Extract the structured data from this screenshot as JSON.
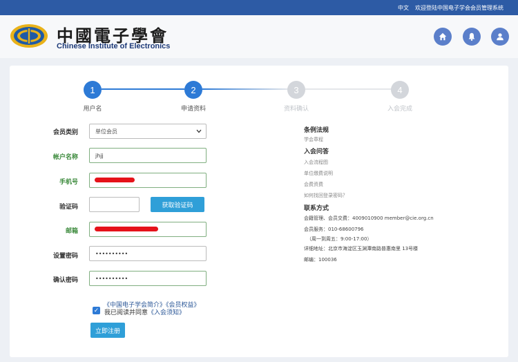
{
  "topbar": {
    "language": "中文",
    "welcome": "欢迎登陆中国电子学会会员管理系统"
  },
  "header": {
    "logo_cn": "中國電子學會",
    "logo_en": "Chinese Institute of Electronics"
  },
  "steps": [
    {
      "num": "1",
      "label": "用户名",
      "state": "active"
    },
    {
      "num": "2",
      "label": "申请资料",
      "state": "active"
    },
    {
      "num": "3",
      "label": "资料确认",
      "state": "off"
    },
    {
      "num": "4",
      "label": "入会完成",
      "state": "off"
    }
  ],
  "form": {
    "member_type": {
      "label": "会员类别",
      "value": "单位会员"
    },
    "account": {
      "label": "帐户名称",
      "value": "jhjj"
    },
    "phone": {
      "label": "手机号"
    },
    "code": {
      "label": "验证码",
      "button": "获取验证码"
    },
    "email": {
      "label": "邮箱"
    },
    "password": {
      "label": "设置密码",
      "value": "••••••••••"
    },
    "confirm": {
      "label": "确认密码",
      "value": "••••••••••"
    },
    "agree_links": "《中国电子学会简介》《会员权益》",
    "agree_prefix": "我已阅读并同意",
    "agree_link": "《入会须知》",
    "submit": "立即注册"
  },
  "right_panel": {
    "rules_title": "条例法规",
    "rules_link": "学会章程",
    "faq_title": "入会问答",
    "faq_links": [
      "入会流程图",
      "单位缴费说明",
      "会费资费",
      "如何找回登录密码？"
    ],
    "contact_title": "联系方式",
    "contact_lines": [
      "会籍管理、会员交费：4009010900 member@cie.org.cn",
      "会员服务：010-68600796",
      "（周一到周五：9:00-17:00）",
      "详细地址：北京市海淀区玉渊潭南路普惠南里 13号楼",
      "邮编：100036"
    ]
  },
  "colors": {
    "topbar": "#2d5ba5",
    "accent": "#2d7ad6",
    "button": "#2f9fd8",
    "icon": "#5b7fca"
  }
}
